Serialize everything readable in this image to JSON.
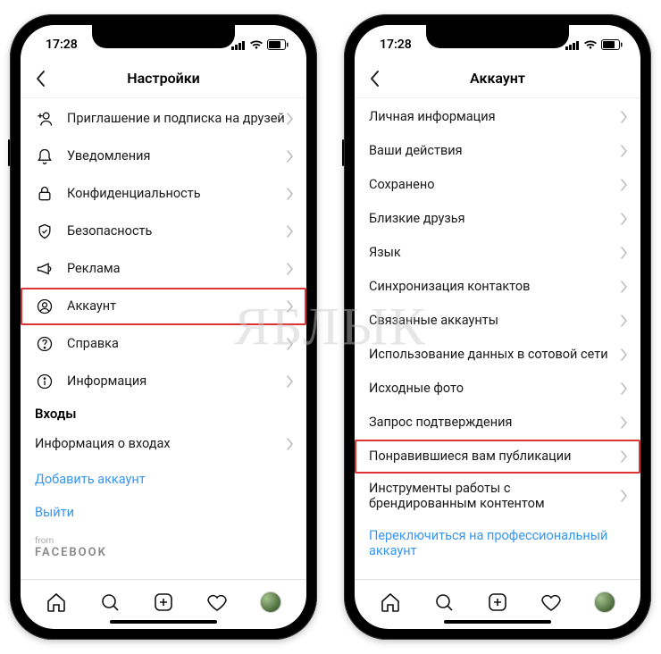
{
  "status": {
    "time": "17:28"
  },
  "watermark": "ЯБЛЫК",
  "left": {
    "header": {
      "title": "Настройки"
    },
    "rows": [
      {
        "icon": "invite",
        "label": "Приглашение и подписка на друзей"
      },
      {
        "icon": "bell",
        "label": "Уведомления"
      },
      {
        "icon": "lock",
        "label": "Конфиденциальность"
      },
      {
        "icon": "shield",
        "label": "Безопасность"
      },
      {
        "icon": "mega",
        "label": "Реклама"
      },
      {
        "icon": "account",
        "label": "Аккаунт"
      },
      {
        "icon": "help",
        "label": "Справка"
      },
      {
        "icon": "info",
        "label": "Информация"
      }
    ],
    "section_logins": "Входы",
    "login_info": "Информация о входах",
    "add_account": "Добавить аккаунт",
    "logout": "Выйти",
    "from": "from",
    "facebook": "FACEBOOK"
  },
  "right": {
    "header": {
      "title": "Аккаунт"
    },
    "rows": [
      "Личная информация",
      "Ваши действия",
      "Сохранено",
      "Близкие друзья",
      "Язык",
      "Синхронизация контактов",
      "Связанные аккаунты",
      "Использование данных в сотовой сети",
      "Исходные фото",
      "Запрос подтверждения",
      "Понравившиеся вам публикации",
      "Инструменты работы с брендированным контентом"
    ],
    "switch_pro": "Переключиться на профессиональный аккаунт"
  }
}
